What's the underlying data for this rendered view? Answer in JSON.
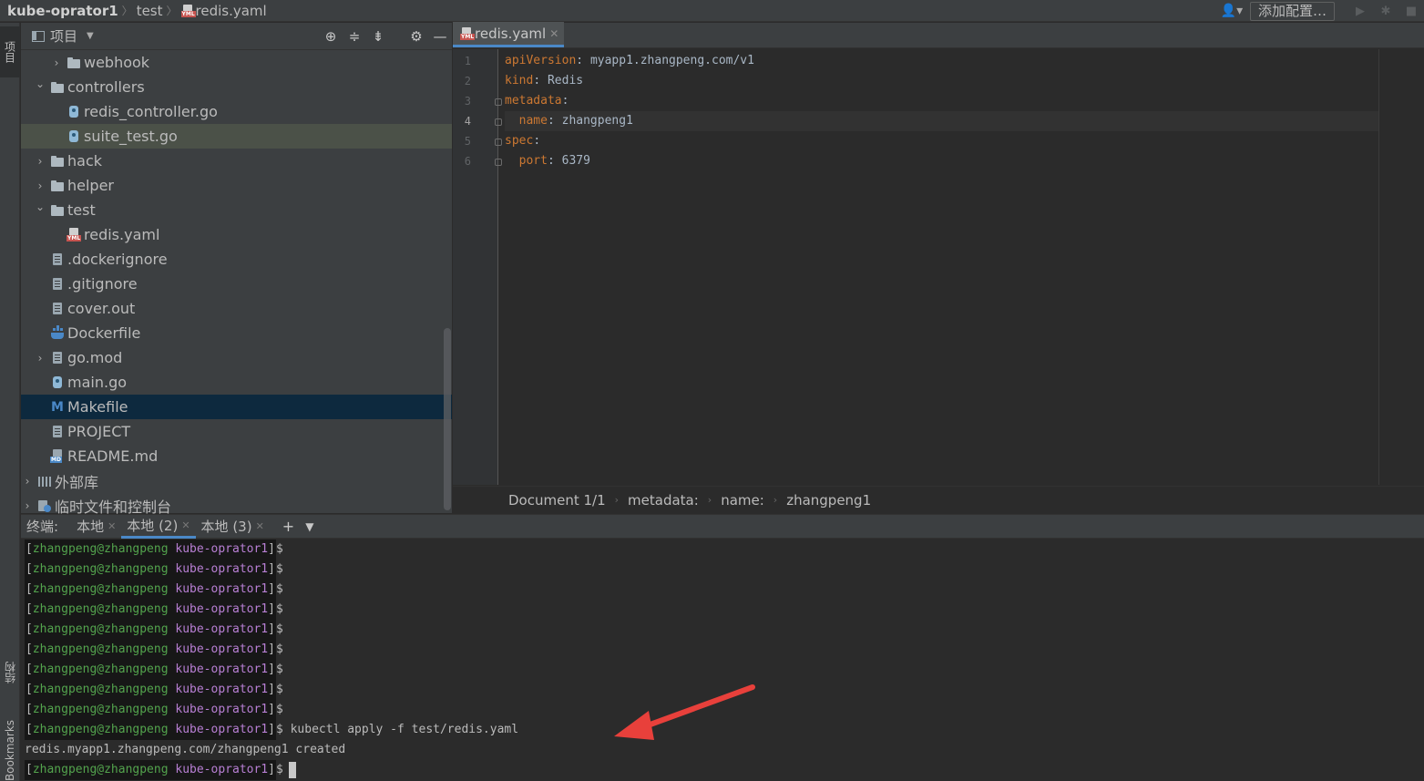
{
  "topbar": {
    "project": "kube-oprator1",
    "folder": "test",
    "file": "redis.yaml",
    "add_config": "添加配置…"
  },
  "left_strip": {
    "project_tab": "项目",
    "structure_tab": "结构",
    "bookmarks_tab": "Bookmarks"
  },
  "project_panel": {
    "title": "项目",
    "tree": [
      {
        "label": "webhook",
        "kind": "folder",
        "expand": "collapsed",
        "depth": 1
      },
      {
        "label": "controllers",
        "kind": "folder",
        "expand": "expanded",
        "depth": 0
      },
      {
        "label": "redis_controller.go",
        "kind": "gofile",
        "expand": "none",
        "depth": 1
      },
      {
        "label": "suite_test.go",
        "kind": "gofile",
        "expand": "none",
        "depth": 1,
        "selected": "green"
      },
      {
        "label": "hack",
        "kind": "folder",
        "expand": "collapsed",
        "depth": 0
      },
      {
        "label": "helper",
        "kind": "folder",
        "expand": "collapsed",
        "depth": 0
      },
      {
        "label": "test",
        "kind": "folder",
        "expand": "expanded",
        "depth": 0
      },
      {
        "label": "redis.yaml",
        "kind": "ymlfile",
        "expand": "none",
        "depth": 1
      },
      {
        "label": ".dockerignore",
        "kind": "file",
        "expand": "none",
        "depth": 0
      },
      {
        "label": ".gitignore",
        "kind": "file",
        "expand": "none",
        "depth": 0
      },
      {
        "label": "cover.out",
        "kind": "file",
        "expand": "none",
        "depth": 0
      },
      {
        "label": "Dockerfile",
        "kind": "docker",
        "expand": "none",
        "depth": 0
      },
      {
        "label": "go.mod",
        "kind": "file",
        "expand": "collapsed",
        "depth": 0
      },
      {
        "label": "main.go",
        "kind": "gofile",
        "expand": "none",
        "depth": 0
      },
      {
        "label": "Makefile",
        "kind": "make",
        "expand": "none",
        "depth": 0,
        "selected": "blue"
      },
      {
        "label": "PROJECT",
        "kind": "file",
        "expand": "none",
        "depth": 0
      },
      {
        "label": "README.md",
        "kind": "mdfile",
        "expand": "none",
        "depth": 0
      },
      {
        "label": "外部库",
        "kind": "lib",
        "expand": "collapsed",
        "depth": -1
      },
      {
        "label": "临时文件和控制台",
        "kind": "scratch",
        "expand": "collapsed",
        "depth": -1
      }
    ]
  },
  "editor": {
    "tab_label": "redis.yaml",
    "current_line": 4,
    "lines": [
      {
        "no": "1",
        "key": "apiVersion",
        "value": "myapp1.zhangpeng.com/v1",
        "indent": ""
      },
      {
        "no": "2",
        "key": "kind",
        "value": "Redis",
        "indent": ""
      },
      {
        "no": "3",
        "key": "metadata",
        "value": "",
        "indent": ""
      },
      {
        "no": "4",
        "key": "name",
        "value": "zhangpeng1",
        "indent": "  "
      },
      {
        "no": "5",
        "key": "spec",
        "value": "",
        "indent": ""
      },
      {
        "no": "6",
        "key": "port",
        "value": "6379",
        "indent": "  "
      }
    ],
    "breadcrumb": [
      "Document 1/1",
      "metadata:",
      "name:",
      "zhangpeng1"
    ]
  },
  "terminal": {
    "label": "终端:",
    "tabs": [
      {
        "label": "本地",
        "active": false
      },
      {
        "label": "本地 (2)",
        "active": true
      },
      {
        "label": "本地 (3)",
        "active": false
      }
    ],
    "prompt_user": "zhangpeng@zhangpeng",
    "prompt_dir": "kube-oprator1",
    "lines": [
      {
        "type": "prompt",
        "cmd": ""
      },
      {
        "type": "prompt",
        "cmd": ""
      },
      {
        "type": "prompt",
        "cmd": ""
      },
      {
        "type": "prompt",
        "cmd": ""
      },
      {
        "type": "prompt",
        "cmd": ""
      },
      {
        "type": "prompt",
        "cmd": ""
      },
      {
        "type": "prompt",
        "cmd": ""
      },
      {
        "type": "prompt",
        "cmd": ""
      },
      {
        "type": "prompt",
        "cmd": ""
      },
      {
        "type": "prompt",
        "cmd": "kubectl apply -f test/redis.yaml"
      },
      {
        "type": "output",
        "text": "redis.myapp1.zhangpeng.com/zhangpeng1 created"
      },
      {
        "type": "prompt",
        "cmd": "",
        "cursor": true
      }
    ]
  },
  "colors": {
    "annotation_arrow": "#e8403b",
    "yaml_key": "#cc7832",
    "prompt_user": "#53a34d",
    "prompt_dir": "#b87fd4"
  }
}
